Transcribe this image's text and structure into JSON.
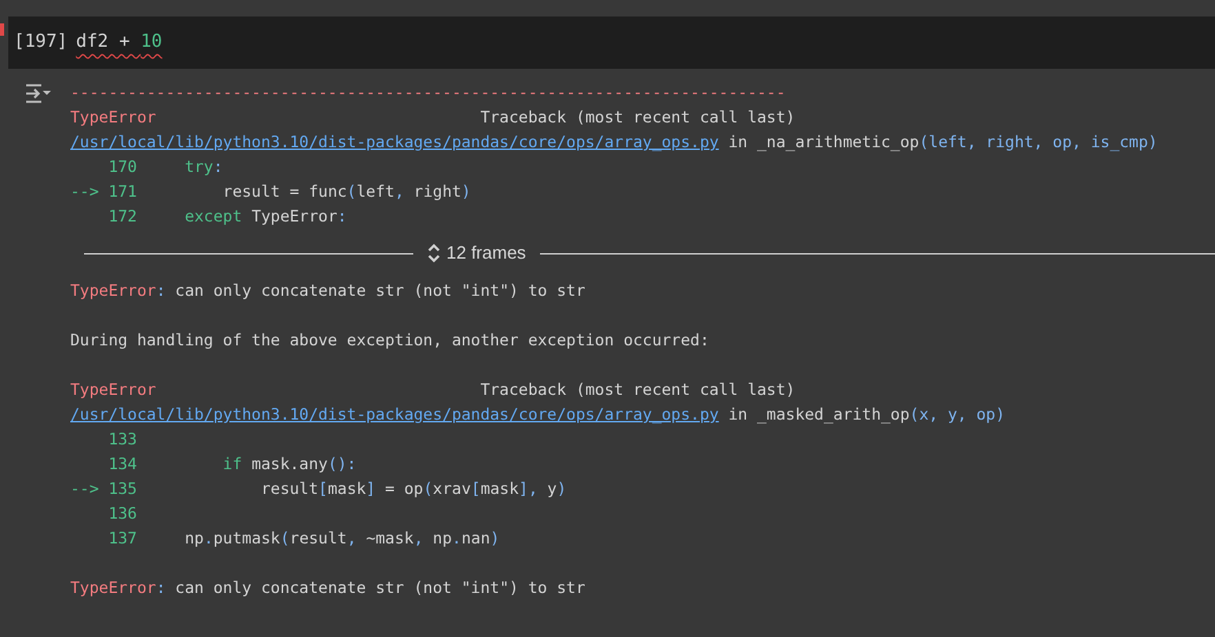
{
  "cell": {
    "prompt": "[197]",
    "squiggle": true,
    "code": [
      {
        "kind": "text",
        "text": "df2 + "
      },
      {
        "kind": "num",
        "text": "10"
      }
    ]
  },
  "output": [
    {
      "kind": "line",
      "segments": [
        {
          "kind": "err",
          "text": "---------------------------------------------------------------------------"
        }
      ]
    },
    {
      "kind": "line",
      "segments": [
        {
          "kind": "err",
          "text": "TypeError"
        },
        {
          "kind": "text",
          "text": "                                  Traceback (most recent call last)"
        }
      ]
    },
    {
      "kind": "line",
      "segments": [
        {
          "kind": "link",
          "text": "/usr/local/lib/python3.10/dist-packages/pandas/core/ops/array_ops.py"
        },
        {
          "kind": "text",
          "text": " in _na_arithmetic_op"
        },
        {
          "kind": "punct",
          "text": "(left, right, op, is_cmp)"
        }
      ]
    },
    {
      "kind": "line",
      "segments": [
        {
          "kind": "num",
          "text": "    170"
        },
        {
          "kind": "kw",
          "text": "     try"
        },
        {
          "kind": "punct",
          "text": ":"
        }
      ]
    },
    {
      "kind": "line",
      "segments": [
        {
          "kind": "num",
          "text": "--> 171"
        },
        {
          "kind": "text",
          "text": "         result = func"
        },
        {
          "kind": "punct",
          "text": "("
        },
        {
          "kind": "text",
          "text": "left"
        },
        {
          "kind": "punct",
          "text": ","
        },
        {
          "kind": "text",
          "text": " right"
        },
        {
          "kind": "punct",
          "text": ")"
        }
      ]
    },
    {
      "kind": "line",
      "segments": [
        {
          "kind": "num",
          "text": "    172"
        },
        {
          "kind": "kw",
          "text": "     except"
        },
        {
          "kind": "text",
          "text": " TypeError"
        },
        {
          "kind": "punct",
          "text": ":"
        }
      ]
    },
    {
      "kind": "frames",
      "label": "12 frames"
    },
    {
      "kind": "line",
      "segments": [
        {
          "kind": "err",
          "text": "TypeError"
        },
        {
          "kind": "punct",
          "text": ":"
        },
        {
          "kind": "text",
          "text": " can only concatenate str (not \"int\") to str"
        }
      ]
    },
    {
      "kind": "blank"
    },
    {
      "kind": "line",
      "segments": [
        {
          "kind": "text",
          "text": "During handling of the above exception, another exception occurred:"
        }
      ]
    },
    {
      "kind": "blank"
    },
    {
      "kind": "line",
      "segments": [
        {
          "kind": "err",
          "text": "TypeError"
        },
        {
          "kind": "text",
          "text": "                                  Traceback (most recent call last)"
        }
      ]
    },
    {
      "kind": "line",
      "segments": [
        {
          "kind": "link",
          "text": "/usr/local/lib/python3.10/dist-packages/pandas/core/ops/array_ops.py"
        },
        {
          "kind": "text",
          "text": " in _masked_arith_op"
        },
        {
          "kind": "punct",
          "text": "(x, y, op)"
        }
      ]
    },
    {
      "kind": "line",
      "segments": [
        {
          "kind": "num",
          "text": "    133"
        }
      ]
    },
    {
      "kind": "line",
      "segments": [
        {
          "kind": "num",
          "text": "    134"
        },
        {
          "kind": "kw",
          "text": "         if"
        },
        {
          "kind": "text",
          "text": " mask.any"
        },
        {
          "kind": "punct",
          "text": "():"
        }
      ]
    },
    {
      "kind": "line",
      "segments": [
        {
          "kind": "num",
          "text": "--> 135"
        },
        {
          "kind": "text",
          "text": "             result"
        },
        {
          "kind": "punct",
          "text": "["
        },
        {
          "kind": "text",
          "text": "mask"
        },
        {
          "kind": "punct",
          "text": "]"
        },
        {
          "kind": "text",
          "text": " = op"
        },
        {
          "kind": "punct",
          "text": "("
        },
        {
          "kind": "text",
          "text": "xrav"
        },
        {
          "kind": "punct",
          "text": "["
        },
        {
          "kind": "text",
          "text": "mask"
        },
        {
          "kind": "punct",
          "text": "],"
        },
        {
          "kind": "text",
          "text": " y"
        },
        {
          "kind": "punct",
          "text": ")"
        }
      ]
    },
    {
      "kind": "line",
      "segments": [
        {
          "kind": "num",
          "text": "    136"
        }
      ]
    },
    {
      "kind": "line",
      "segments": [
        {
          "kind": "num",
          "text": "    137"
        },
        {
          "kind": "text",
          "text": "     np"
        },
        {
          "kind": "punct",
          "text": "."
        },
        {
          "kind": "text",
          "text": "putmask"
        },
        {
          "kind": "punct",
          "text": "("
        },
        {
          "kind": "text",
          "text": "result"
        },
        {
          "kind": "punct",
          "text": ","
        },
        {
          "kind": "text",
          "text": " ~mask"
        },
        {
          "kind": "punct",
          "text": ","
        },
        {
          "kind": "text",
          "text": " np"
        },
        {
          "kind": "punct",
          "text": "."
        },
        {
          "kind": "text",
          "text": "nan"
        },
        {
          "kind": "punct",
          "text": ")"
        }
      ]
    },
    {
      "kind": "blank"
    },
    {
      "kind": "line",
      "segments": [
        {
          "kind": "err",
          "text": "TypeError"
        },
        {
          "kind": "punct",
          "text": ":"
        },
        {
          "kind": "text",
          "text": " can only concatenate str (not \"int\") to str"
        }
      ]
    }
  ]
}
